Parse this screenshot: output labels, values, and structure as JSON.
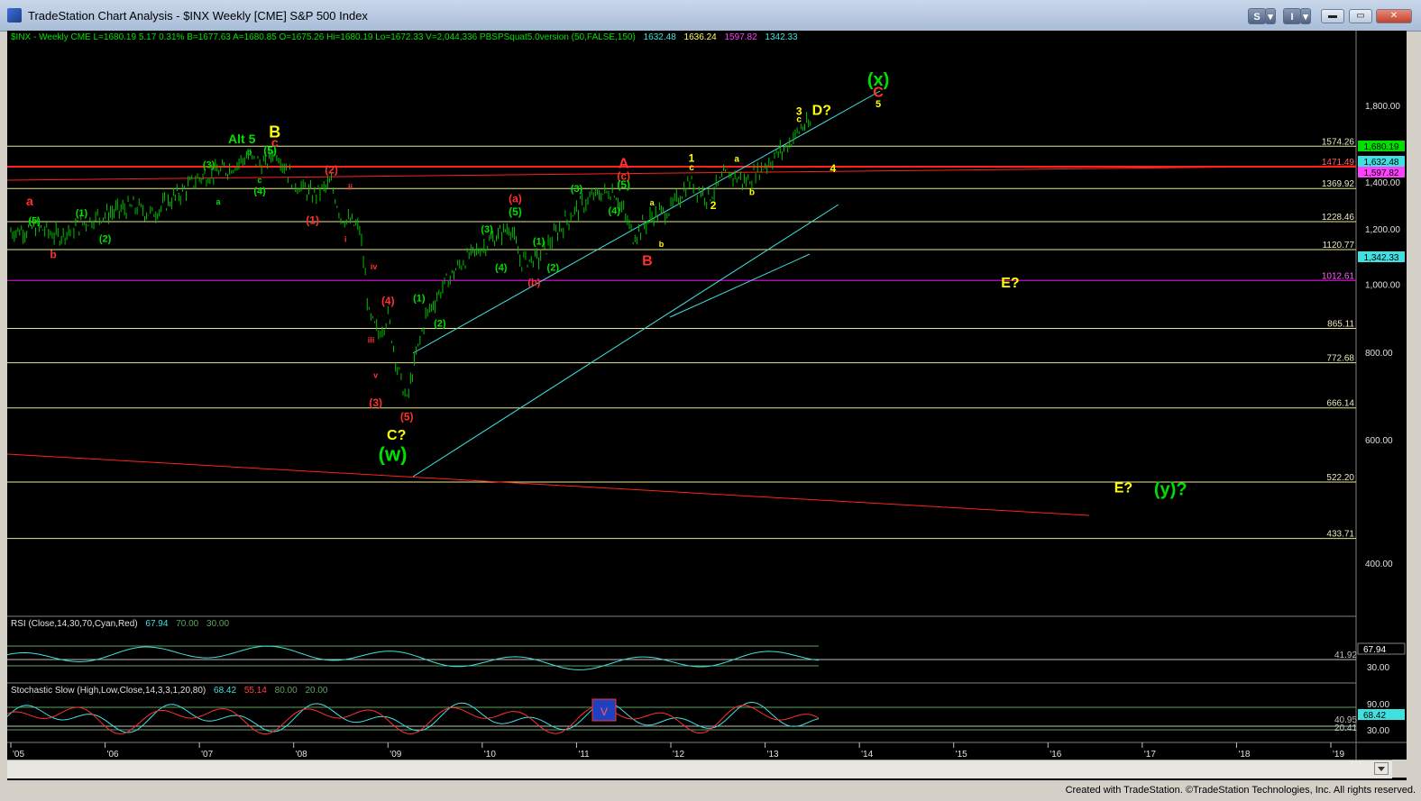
{
  "window": {
    "title": "TradeStation Chart Analysis - $INX Weekly [CME] S&P 500 Index",
    "btn_s": "S",
    "btn_menu": "▾",
    "btn_i": "I",
    "min": "▬",
    "max": "▭",
    "restore": "▢",
    "close": "✕"
  },
  "status": {
    "copyright": "Created with TradeStation. ©TradeStation Technologies, Inc. All rights reserved."
  },
  "header": {
    "symbol": "$INX - Weekly  CME  L=1680.19  5.17  0.31%  B=1677.63  A=1680.85  O=1675.26  Hi=1680.19  Lo=1672.33  V=2,044,336  PBSPSquat5.0version (50,FALSE,150)",
    "ind1": "1632.48",
    "ind2": "1636.24",
    "ind3": "1597.82",
    "ind4": "1342.33"
  },
  "colors": {
    "up": "#00c000",
    "red": "#e00000",
    "yellow": "#ffff00",
    "green": "#00e000",
    "cyan": "#40e0e0",
    "magenta": "#ff00ff",
    "hline": "#e8e890"
  },
  "chart_data": {
    "type": "line",
    "title": "$INX Weekly [CME] S&P 500 Index",
    "y_axis_ticks": [
      "1,800.00",
      "1,400.00",
      "1,200.00",
      "1,000.00",
      "800.00",
      "600.00",
      "400.00"
    ],
    "x_axis_ticks": [
      "'05",
      "'06",
      "'07",
      "'08",
      "'09",
      "'10",
      "'11",
      "'12",
      "'13",
      "'14",
      "'15",
      "'16",
      "'17",
      "'18",
      "'19"
    ],
    "horizontal_levels": [
      "1574.26",
      "1471.49",
      "1369.92",
      "1228.46",
      "1120.77",
      "1012.61",
      "865.11",
      "772.68",
      "666.14",
      "522.20",
      "433.71"
    ],
    "price_labels": {
      "last": "1,680.19",
      "ma1": "1,632.48",
      "ma2": "1,597.82",
      "ma3": "1,342.33"
    },
    "series": [
      {
        "x": [
          2005.0,
          2005.3,
          2005.5,
          2005.8,
          2006.0,
          2006.3,
          2006.5,
          2006.8,
          2007.0,
          2007.3,
          2007.5,
          2007.7,
          2007.8,
          2008.0,
          2008.2,
          2008.4,
          2008.5,
          2008.7,
          2008.8,
          2008.9,
          2009.0,
          2009.1,
          2009.2,
          2009.4,
          2009.6,
          2009.8,
          2010.0,
          2010.3,
          2010.4,
          2010.6,
          2010.8,
          2011.0,
          2011.2,
          2011.4,
          2011.6,
          2011.8,
          2012.0,
          2012.2,
          2012.4,
          2012.6,
          2012.8,
          2013.0,
          2013.2,
          2013.4,
          2013.5
        ],
        "values": [
          1190,
          1205,
          1170,
          1230,
          1260,
          1290,
          1260,
          1350,
          1420,
          1460,
          1520,
          1480,
          1560,
          1400,
          1340,
          1390,
          1250,
          1200,
          900,
          850,
          900,
          760,
          680,
          900,
          1000,
          1080,
          1130,
          1210,
          1080,
          1090,
          1190,
          1280,
          1340,
          1360,
          1170,
          1250,
          1280,
          1400,
          1330,
          1440,
          1400,
          1480,
          1560,
          1680,
          1680
        ]
      }
    ],
    "wave_labels": [
      "(x)",
      "C",
      "5",
      "3",
      "D?",
      "c",
      "1",
      "c",
      "a",
      "4",
      "b",
      "2",
      "A",
      "(c)",
      "(5)",
      "(4)",
      "(3)",
      "(a)",
      "(5)",
      "(3)",
      "(1)",
      "(2)",
      "(4)",
      "(b)",
      "b",
      "a",
      "B",
      "B",
      "Alt 5",
      "c",
      "b",
      "(5)",
      "(3)",
      "a",
      "c",
      "(4)",
      "(2)",
      "ii",
      "(1)",
      "i",
      "iv",
      "(4)",
      "(1)",
      "(2)",
      "iii",
      "v",
      "(3)",
      "(5)",
      "C?",
      "(w)",
      "a",
      "(5)",
      "(1)",
      "(2)",
      "b",
      "E?",
      "E?",
      "(y)?"
    ]
  },
  "rsi": {
    "label": "RSI (Close,14,30,70,Cyan,Red)",
    "v1": "67.94",
    "v2": "70.00",
    "v3": "30.00",
    "ticks": [
      "67.94",
      "41.92",
      "30.00"
    ]
  },
  "stoch": {
    "label": "Stochastic Slow (High,Low,Close,14,3,3,1,20,80)",
    "v1": "68.42",
    "v2": "55.14",
    "v3": "80.00",
    "v4": "20.00",
    "ticks": [
      "90.00",
      "40.95",
      "68.42",
      "20.41",
      "30.00"
    ],
    "marker": "V"
  }
}
